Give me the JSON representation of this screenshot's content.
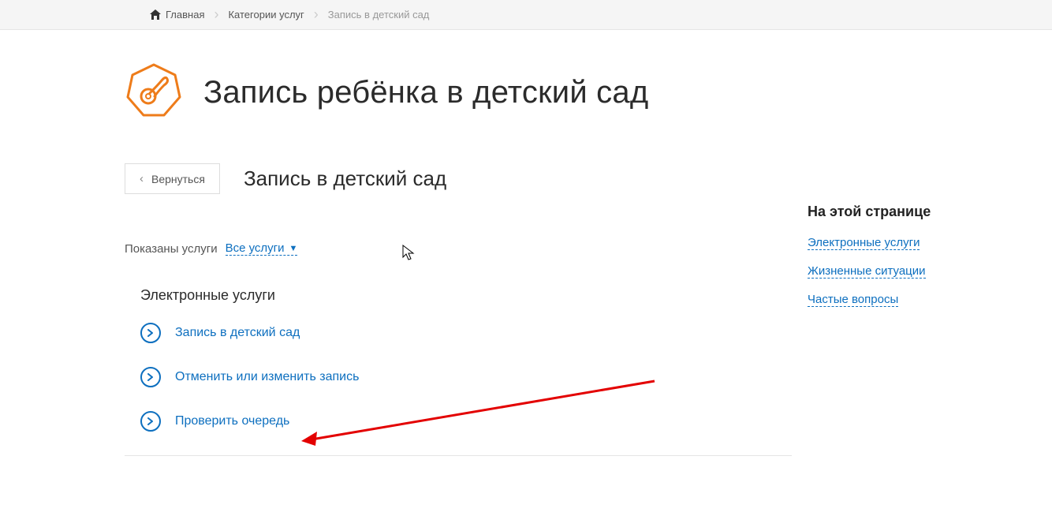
{
  "breadcrumb": {
    "home": "Главная",
    "categories": "Категории услуг",
    "current": "Запись в детский сад"
  },
  "page": {
    "title": "Запись ребёнка в детский сад"
  },
  "back_button": "Вернуться",
  "sub_title": "Запись в детский сад",
  "filter": {
    "label": "Показаны услуги",
    "value": "Все услуги"
  },
  "section_heading": "Электронные услуги",
  "services": [
    "Запись в детский сад",
    "Отменить или изменить запись",
    "Проверить очередь"
  ],
  "sidebar": {
    "heading": "На этой странице",
    "links": [
      "Электронные услуги",
      "Жизненные ситуации",
      "Частые вопросы"
    ]
  }
}
